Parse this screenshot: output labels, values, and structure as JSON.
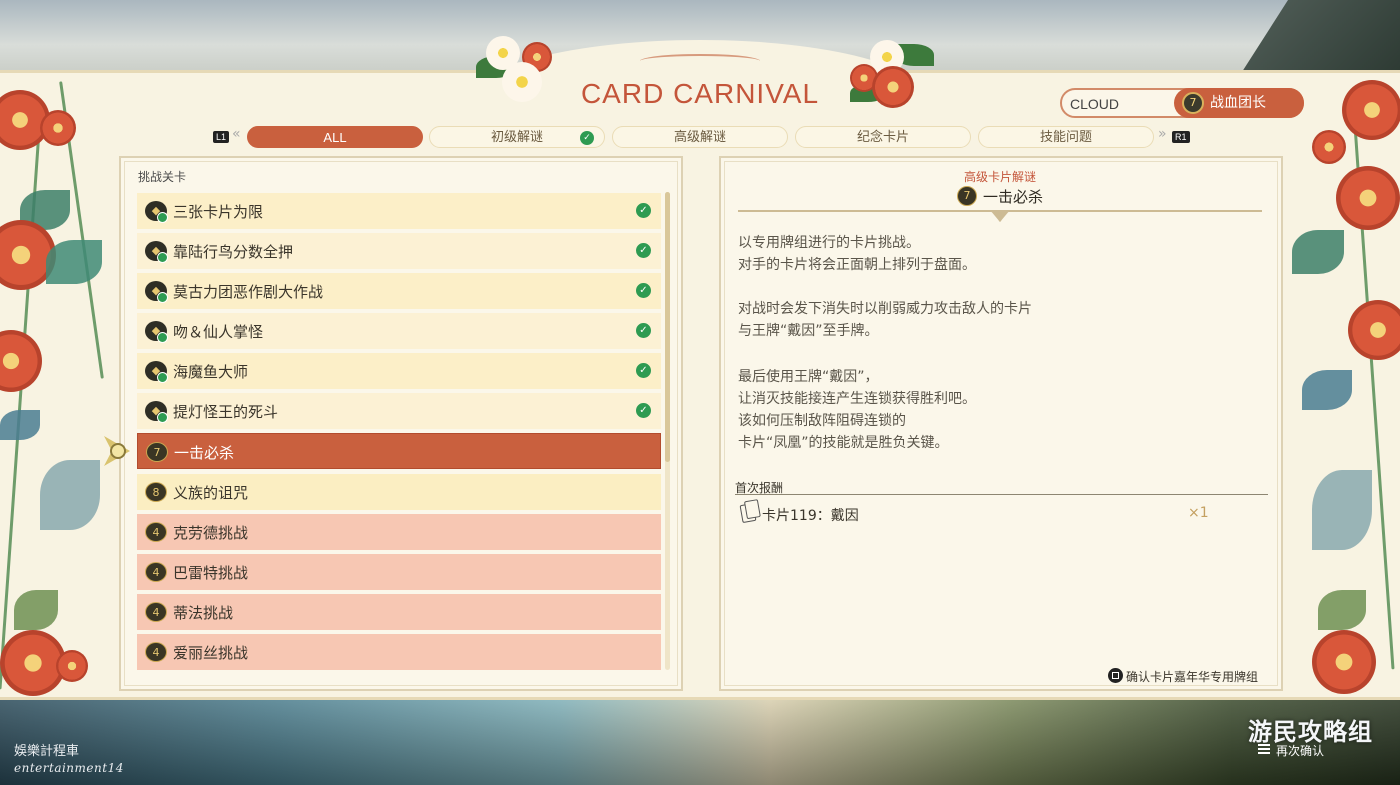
{
  "header": {
    "title": "CARD CARNIVAL",
    "player_name": "CLOUD",
    "rank_badge": "7",
    "rank_title": "战血团长"
  },
  "tabs": {
    "left_button": "L1",
    "right_button": "R1",
    "items": [
      {
        "label": "ALL",
        "active": true,
        "completed": false
      },
      {
        "label": "初级解谜",
        "active": false,
        "completed": true
      },
      {
        "label": "高级解谜",
        "active": false,
        "completed": false
      },
      {
        "label": "纪念卡片",
        "active": false,
        "completed": false
      },
      {
        "label": "技能问题",
        "active": false,
        "completed": false
      }
    ]
  },
  "challenge_list": {
    "section_label": "挑战关卡",
    "items": [
      {
        "label": "三张卡片为限",
        "emblem": "",
        "completed": true,
        "style": "done"
      },
      {
        "label": "靠陆行鸟分数全押",
        "emblem": "",
        "completed": true,
        "style": "done"
      },
      {
        "label": "莫古力团恶作剧大作战",
        "emblem": "",
        "completed": true,
        "style": "done"
      },
      {
        "label": "吻＆仙人掌怪",
        "emblem": "",
        "completed": true,
        "style": "done"
      },
      {
        "label": "海魔鱼大师",
        "emblem": "",
        "completed": true,
        "style": "done"
      },
      {
        "label": "提灯怪王的死斗",
        "emblem": "",
        "completed": true,
        "style": "done"
      },
      {
        "label": "一击必杀",
        "emblem": "7",
        "completed": false,
        "style": "selected"
      },
      {
        "label": "义族的诅咒",
        "emblem": "8",
        "completed": false,
        "style": "pending"
      },
      {
        "label": "克劳德挑战",
        "emblem": "4",
        "completed": false,
        "style": "salmon"
      },
      {
        "label": "巴雷特挑战",
        "emblem": "4",
        "completed": false,
        "style": "salmon"
      },
      {
        "label": "蒂法挑战",
        "emblem": "4",
        "completed": false,
        "style": "salmon"
      },
      {
        "label": "爱丽丝挑战",
        "emblem": "4",
        "completed": false,
        "style": "salmon"
      }
    ]
  },
  "detail": {
    "category": "高级卡片解谜",
    "emblem": "7",
    "title": "一击必杀",
    "description": [
      "以专用牌组进行的卡片挑战。",
      "对手的卡片将会正面朝上排列于盘面。",
      "",
      "对战时会发下消失时以削弱威力攻击敌人的卡片",
      "与王牌“戴因”至手牌。",
      "",
      "最后使用王牌“戴因”，",
      "让消灭技能接连产生连锁获得胜利吧。",
      "该如何压制敌阵阻碍连锁的",
      "卡片“凤凰”的技能就是胜负关键。"
    ],
    "reward_label": "首次报酬",
    "reward_name": "卡片119：戴因",
    "reward_qty": "×1",
    "confirm_hint": "确认卡片嘉年华专用牌组"
  },
  "footer": {
    "watermark_cn": "娛樂計程車",
    "watermark_en": "entertainment14",
    "watermark_site": "游民攻略组",
    "recheck_label": "再次确认"
  },
  "colors": {
    "accent": "#c9603e",
    "check": "#2e9b52",
    "cream": "#f8f3e2",
    "title": "#c4553a"
  }
}
